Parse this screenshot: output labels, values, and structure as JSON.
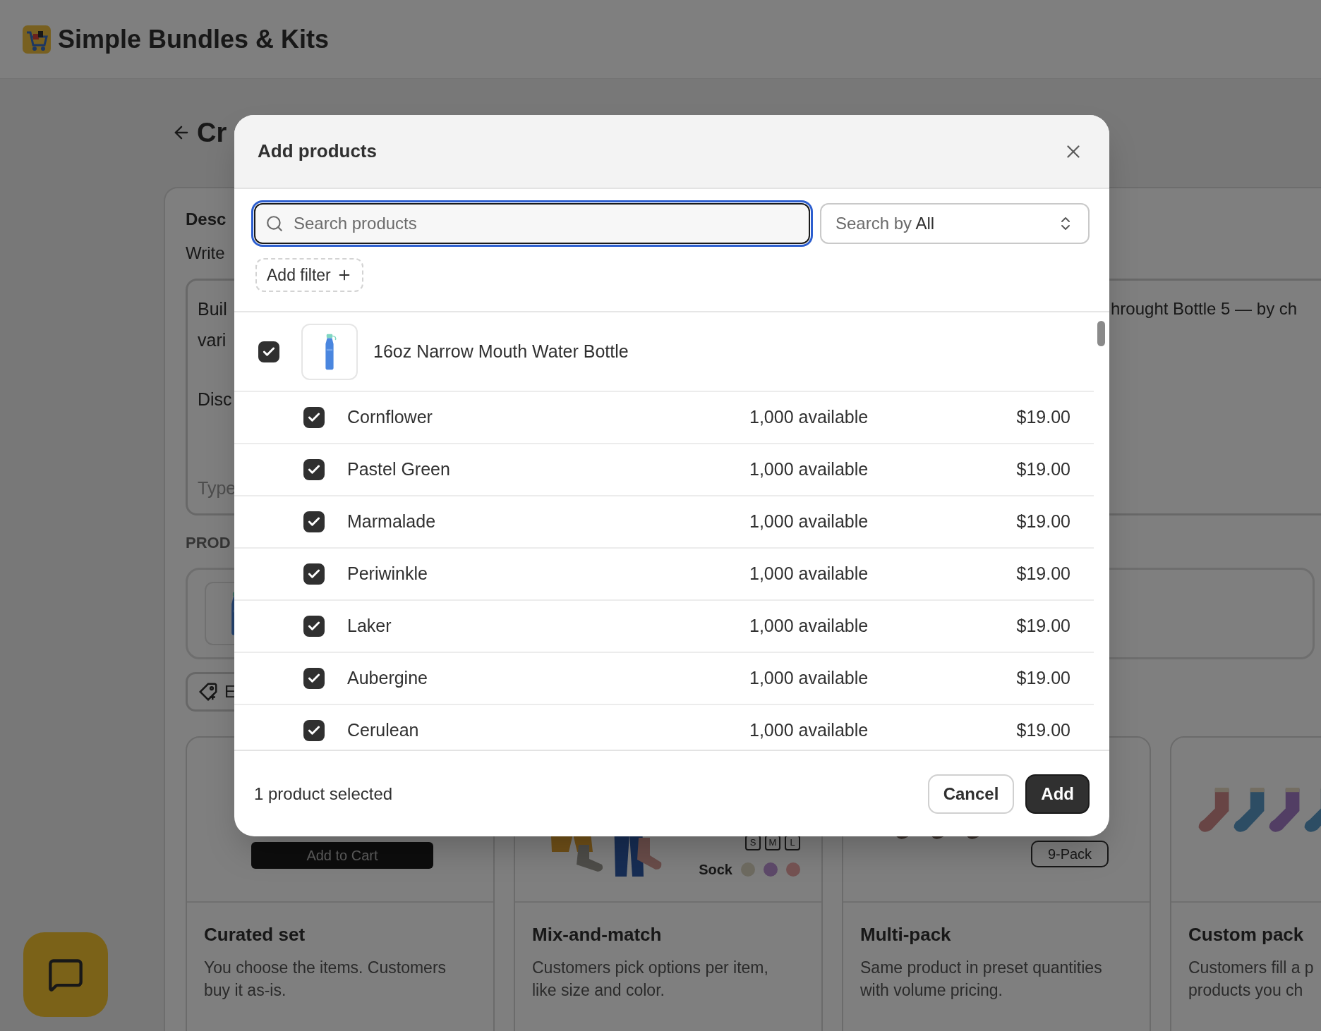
{
  "app": {
    "title": "Simple Bundles & Kits"
  },
  "page": {
    "title": "Cr",
    "description": {
      "title": "Desc",
      "subtitle": "Write",
      "lines": [
        "Buil",
        "vari"
      ],
      "second_paragraph": "Disc",
      "right_text": "hrought Bottle 5 — by ch",
      "hint": "Type"
    },
    "products_heading": "PROD",
    "product_button": "E",
    "bundle_types": [
      {
        "kind": "curated",
        "title": "Curated set",
        "description_lines": [
          "You choose the items. Customers",
          "buy it as-is."
        ],
        "button": "Add to Cart"
      },
      {
        "kind": "mix",
        "title": "Mix-and-match",
        "description_lines": [
          "Customers pick options per item,",
          "like size and color."
        ],
        "sizes": [
          "S",
          "M",
          "L"
        ],
        "option_label": "Sock",
        "swatches": [
          {
            "color": "#6c695f"
          },
          {
            "color": "#5c4868"
          },
          {
            "color": "#735151"
          }
        ]
      },
      {
        "kind": "multi",
        "title": "Multi-pack",
        "description_lines": [
          "Same product in preset quantities",
          "with volume pricing."
        ],
        "badge": "9-Pack"
      },
      {
        "kind": "custom",
        "title": "Custom pack",
        "description_lines": [
          "Customers fill a p",
          "products you ch"
        ]
      }
    ]
  },
  "modal": {
    "title": "Add products",
    "search": {
      "placeholder": "Search products"
    },
    "search_by": {
      "label": "Search by",
      "value": "All"
    },
    "add_filter": "Add filter",
    "products": [
      {
        "name": "16oz Narrow Mouth Water Bottle",
        "checked": true,
        "variants": [
          {
            "name": "Cornflower",
            "available": "1,000 available",
            "price": "$19.00",
            "checked": true
          },
          {
            "name": "Pastel Green",
            "available": "1,000 available",
            "price": "$19.00",
            "checked": true
          },
          {
            "name": "Marmalade",
            "available": "1,000 available",
            "price": "$19.00",
            "checked": true
          },
          {
            "name": "Periwinkle",
            "available": "1,000 available",
            "price": "$19.00",
            "checked": true
          },
          {
            "name": "Laker",
            "available": "1,000 available",
            "price": "$19.00",
            "checked": true
          },
          {
            "name": "Aubergine",
            "available": "1,000 available",
            "price": "$19.00",
            "checked": true
          },
          {
            "name": "Cerulean",
            "available": "1,000 available",
            "price": "$19.00",
            "checked": true
          }
        ]
      }
    ],
    "selection": "1 product selected",
    "buttons": [
      {
        "label": "Cancel",
        "kind": "secondary"
      },
      {
        "label": "Add",
        "kind": "primary"
      }
    ]
  }
}
